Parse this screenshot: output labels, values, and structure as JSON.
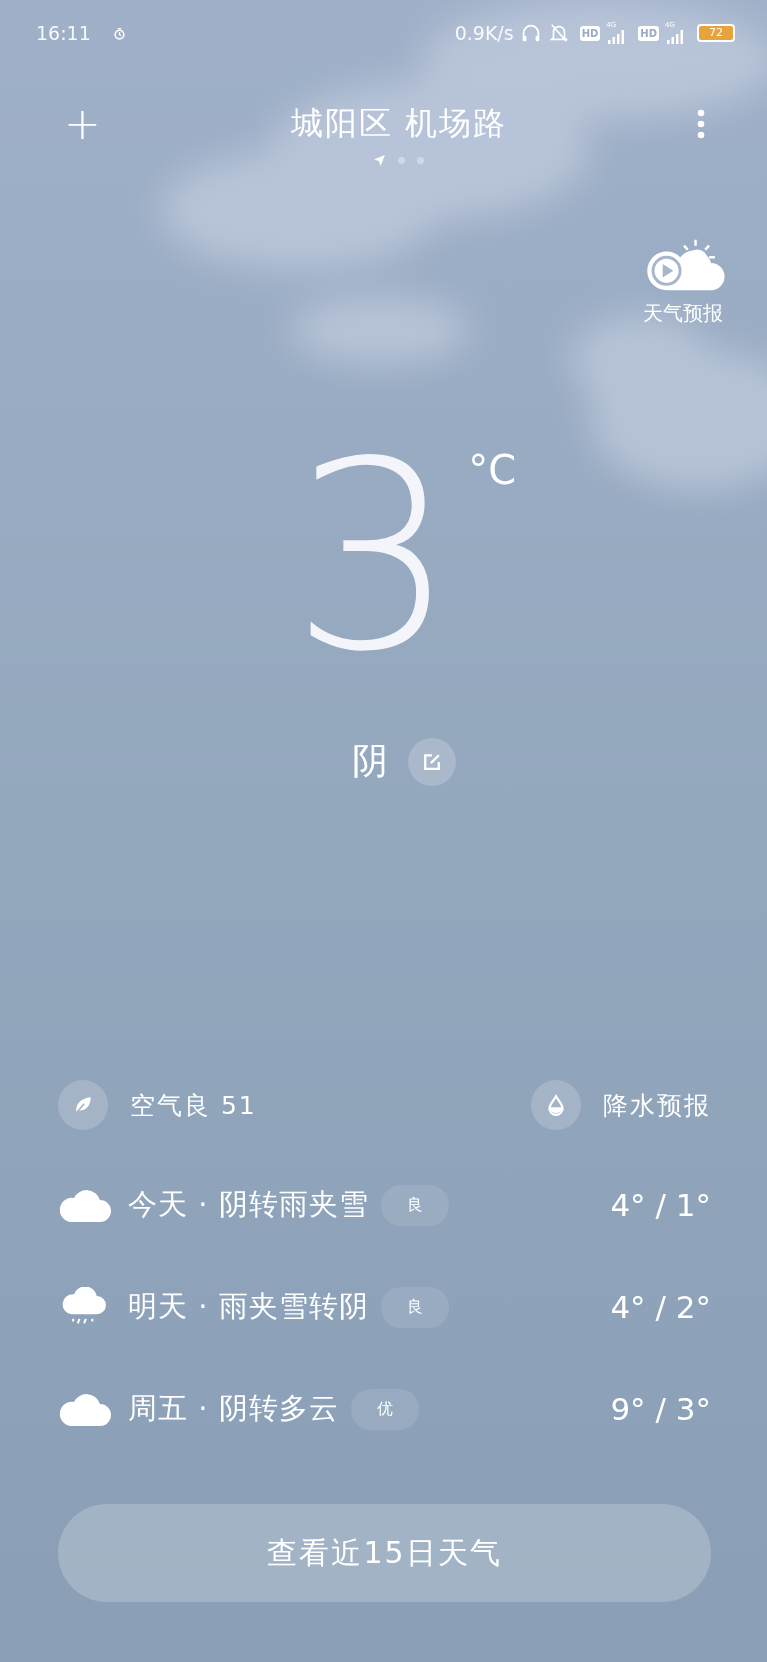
{
  "status_bar": {
    "time": "16:11",
    "net_speed": "0.9K/s",
    "sims": [
      {
        "hd": "HD",
        "network": "4G"
      },
      {
        "hd": "HD",
        "network": "4G"
      }
    ],
    "battery": "72"
  },
  "header": {
    "add": "+",
    "location": "城阳区 机场路",
    "pages": [
      {
        "kind": "location",
        "selected": true
      },
      {
        "kind": "dot",
        "selected": false
      },
      {
        "kind": "dot",
        "selected": false
      }
    ]
  },
  "video_forecast": {
    "label": "天气预报"
  },
  "current": {
    "temperature": "3",
    "unit": "°C",
    "condition": "阴"
  },
  "air_quality": {
    "label": "空气良 51"
  },
  "precipitation": {
    "label": "降水预报"
  },
  "forecast": [
    {
      "kind": "cloudy",
      "day": "今天 · 阴转雨夹雪",
      "aqi": "良",
      "temps": "4° / 1°"
    },
    {
      "kind": "rain",
      "day": "明天 · 雨夹雪转阴",
      "aqi": "良",
      "temps": "4° / 2°"
    },
    {
      "kind": "cloudy",
      "day": "周五 · 阴转多云",
      "aqi": "优",
      "temps": "9° / 3°"
    }
  ],
  "more_button": "查看近15日天气"
}
